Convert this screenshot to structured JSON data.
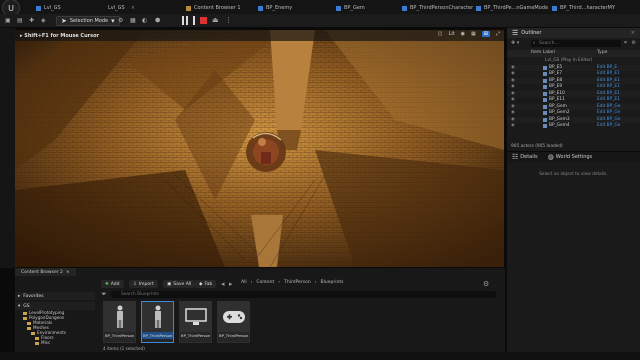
{
  "titlebar": {
    "level_name": "Lvl_GS",
    "tabs": [
      {
        "label": "Lvl_GS"
      },
      {
        "label": "Content Browser 1"
      },
      {
        "label": "BP_Enemy"
      },
      {
        "label": "BP_Gem"
      },
      {
        "label": "BP_ThirdPersonCharacter"
      },
      {
        "label": "BP_ThirdPe...nGameMode"
      },
      {
        "label": "BP_Third...haracterMY"
      }
    ]
  },
  "toolbar": {
    "mode_label": "Selection Mode"
  },
  "viewport": {
    "hint": "Shift+F1 for Mouse Cursor",
    "view_mode": "Lit",
    "perspective_icon": "perspective-icon"
  },
  "outliner": {
    "tab_label": "Outliner",
    "search_placeholder": "Search...",
    "col_label": "Item Label",
    "col_type": "Type",
    "level_row": "Lvl_GS (Play In Editor)",
    "rows": [
      {
        "name": "BP_E5",
        "type": "Edit BP_E"
      },
      {
        "name": "BP_E7",
        "type": "Edit BP_E1"
      },
      {
        "name": "BP_E8",
        "type": "Edit BP_E1"
      },
      {
        "name": "BP_E9",
        "type": "Edit BP_E1"
      },
      {
        "name": "BP_E10",
        "type": "Edit BP_E1"
      },
      {
        "name": "BP_E11",
        "type": "Edit BP_E1"
      },
      {
        "name": "BP_Gem",
        "type": "Edit BP_Ge"
      },
      {
        "name": "BP_Gem2",
        "type": "Edit BP_Ge"
      },
      {
        "name": "BP_Gem3",
        "type": "Edit BP_Ge"
      },
      {
        "name": "BP_Gem4",
        "type": "Edit BP_Ge"
      }
    ],
    "actor_count": "905 actors (905 loaded)"
  },
  "details": {
    "tab_details": "Details",
    "tab_world": "World Settings",
    "empty_message": "Select an object to view details."
  },
  "content_browser": {
    "tab_label": "Content Browser 2",
    "add_label": "Add",
    "import_label": "Import",
    "save_all_label": "Save All",
    "fab_label": "Fab",
    "breadcrumbs": [
      "All",
      "Content",
      "ThirdPerson",
      "Blueprints"
    ],
    "search_placeholder": "Search Blueprints",
    "favorites_label": "Favorites",
    "root_label": "GS",
    "tree": [
      {
        "label": "LevelPrototyping",
        "indent": 1
      },
      {
        "label": "PolygonDungeon",
        "indent": 1
      },
      {
        "label": "Materials",
        "indent": 2
      },
      {
        "label": "Meshes",
        "indent": 2
      },
      {
        "label": "Environments",
        "indent": 3
      },
      {
        "label": "Floors",
        "indent": 4
      },
      {
        "label": "Misc",
        "indent": 4
      }
    ],
    "collections_label": "Collections",
    "assets": [
      {
        "label": "BP_ThirdPerson",
        "thumb": "character-icon",
        "selected": false
      },
      {
        "label": "BP_ThirdPerson",
        "thumb": "character-icon",
        "selected": true
      },
      {
        "label": "BP_ThirdPerson",
        "thumb": "monitor-icon",
        "selected": false
      },
      {
        "label": "BP_ThirdPerson",
        "thumb": "gamepad-icon",
        "selected": false
      }
    ],
    "items_status": "4 items (1 selected)"
  }
}
